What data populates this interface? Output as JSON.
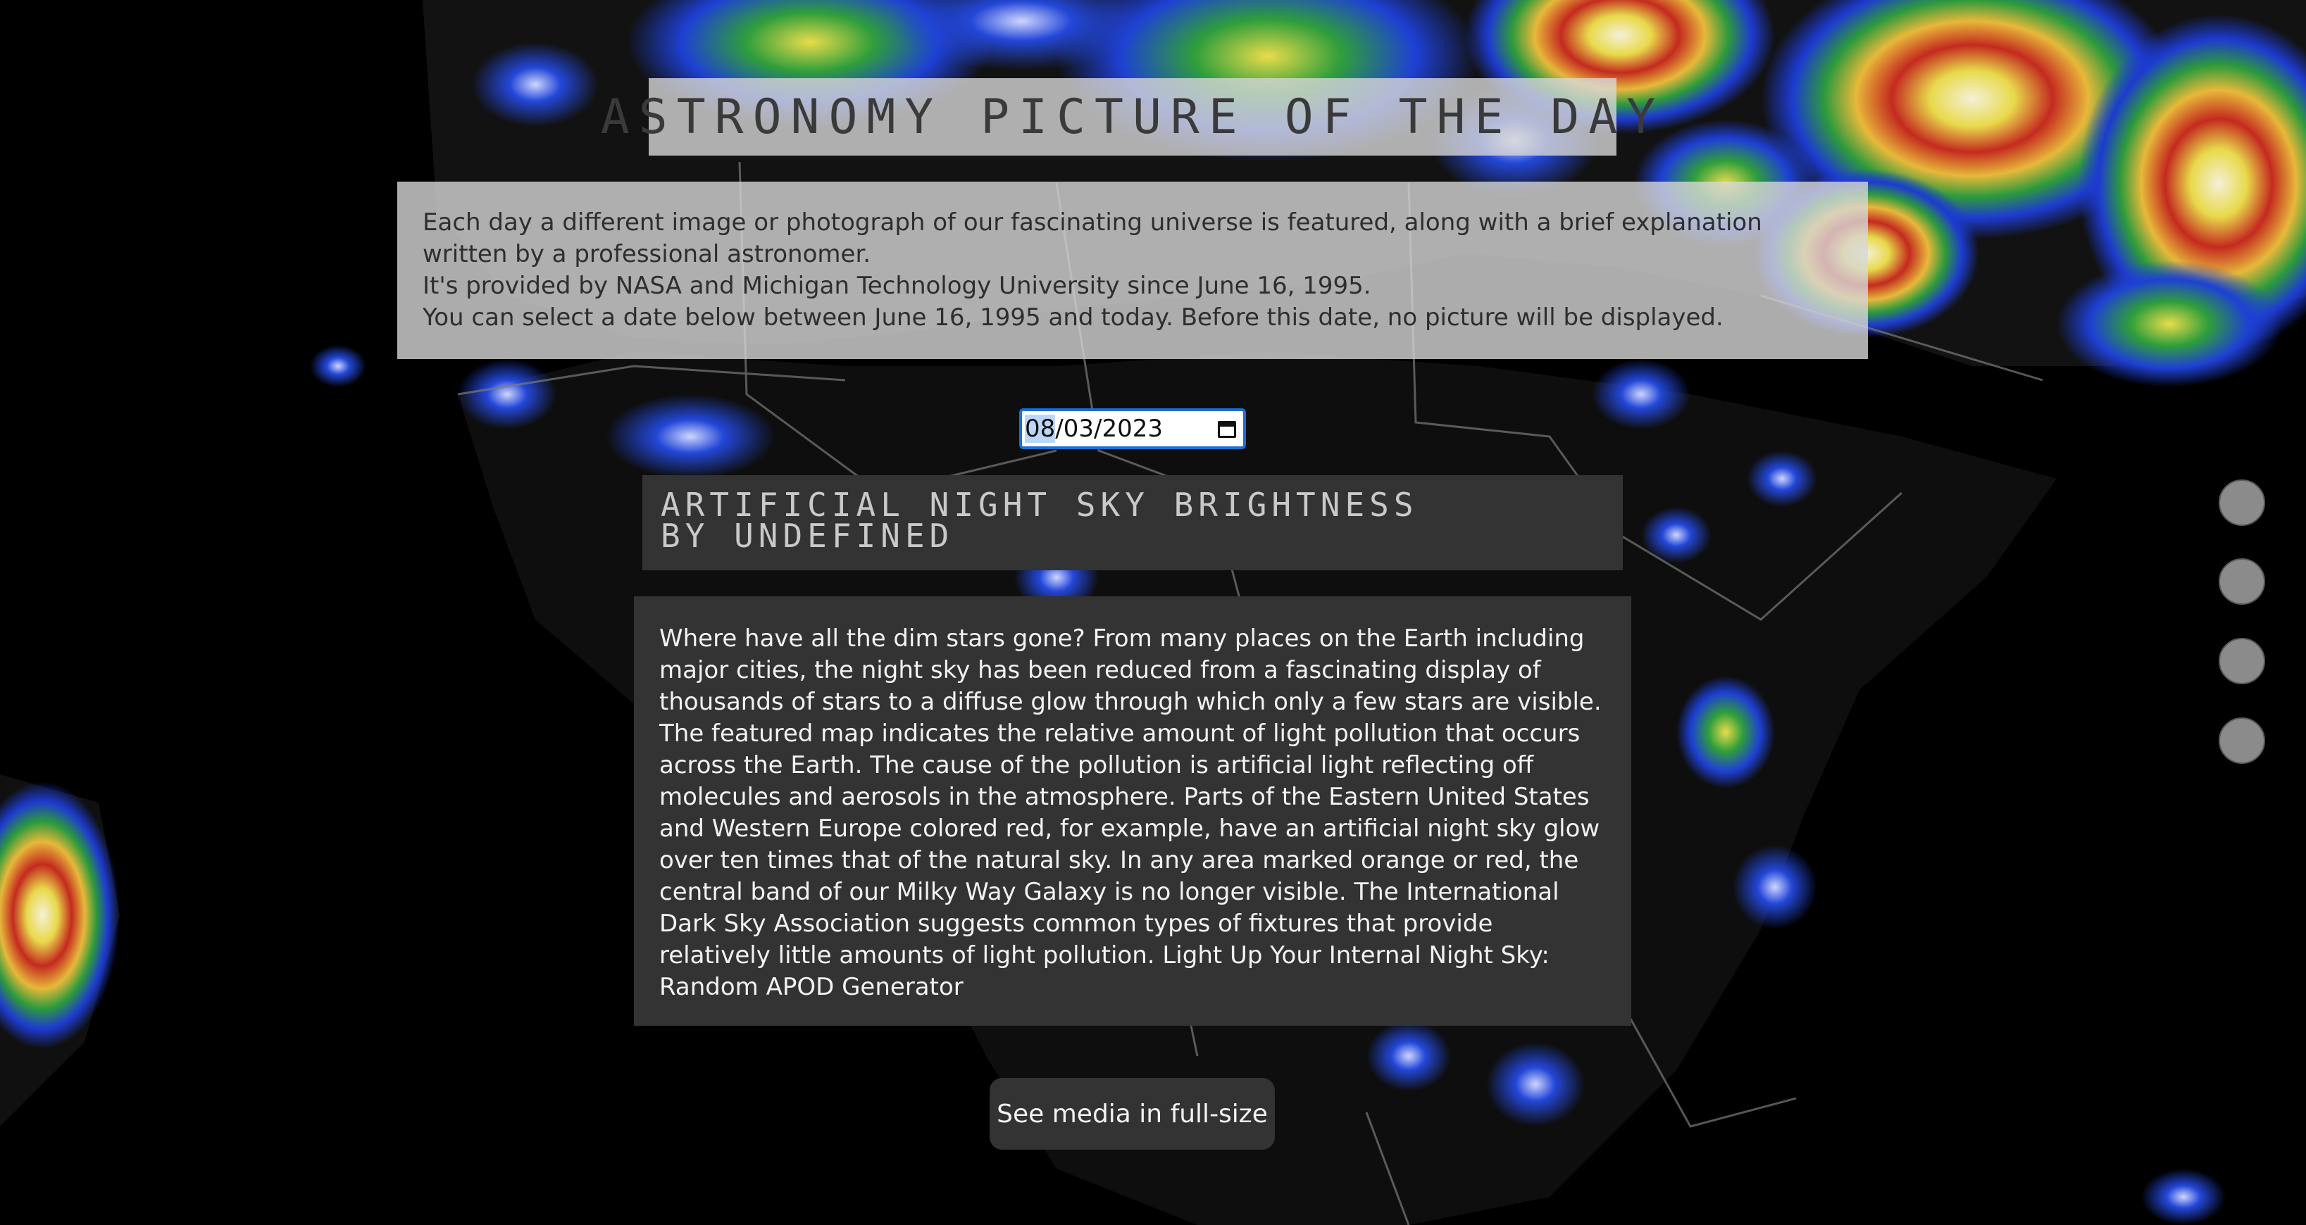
{
  "header": {
    "title": "ASTRONOMY PICTURE OF THE DAY"
  },
  "intro": {
    "line1": "Each day a different image or photograph of our fascinating universe is featured, along with a brief explanation written by a professional astronomer.",
    "line2": "It's provided by NASA and Michigan Technology University since June 16, 1995.",
    "line3": "You can select a date below between June 16, 1995 and today. Before this date, no picture will be displayed."
  },
  "date_picker": {
    "month": "08",
    "rest": "/03/2023",
    "icon": "calendar-icon"
  },
  "post": {
    "title": "Artificial Night Sky Brightness",
    "byline": "by undefined",
    "explanation": "Where have all the dim stars gone? From many places on the Earth including major cities, the night sky has been reduced from a fascinating display of thousands of stars to a diffuse glow through which only a few stars are visible. The featured map indicates the relative amount of light pollution that occurs across the Earth. The cause of the pollution is artificial light reflecting off molecules and aerosols in the atmosphere. Parts of the Eastern United States and Western Europe colored red, for example, have an artificial night sky glow over ten times that of the natural sky. In any area marked orange or red, the central band of our Milky Way Galaxy is no longer visible. The International Dark Sky Association suggests common types of fixtures that provide relatively little amounts of light pollution. Light Up Your Internal Night Sky: Random APOD Generator"
  },
  "actions": {
    "fullsize_label": "See media in full-size"
  },
  "colors": {
    "panel_light": "#d7d7d7",
    "panel_dark": "#333333",
    "focus_ring": "#1a6fd6",
    "map_land": "#111111",
    "light_blue": "#1e3fd0",
    "light_green": "#2ea83a",
    "light_yellow": "#e8e23a",
    "light_red": "#c8202a"
  }
}
